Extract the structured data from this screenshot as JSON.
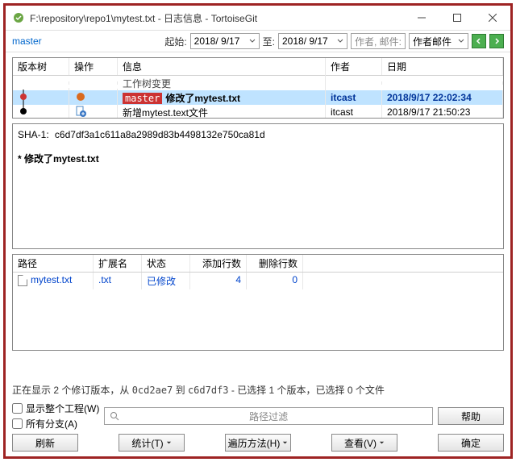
{
  "window": {
    "title": "F:\\repository\\repo1\\mytest.txt - 日志信息 - TortoiseGit"
  },
  "toolbar": {
    "branch": "master",
    "from_label": "起始:",
    "from_date": "2018/ 9/17",
    "to_label": "至:",
    "to_date": "2018/ 9/17",
    "search_placeholder": "作者, 邮件:",
    "filter_sel": "作者邮件"
  },
  "grid": {
    "hdr": {
      "tree": "版本树",
      "op": "操作",
      "info": "信息",
      "author": "作者",
      "date": "日期"
    },
    "wtc": "工作树变更",
    "rows": [
      {
        "branch": "master",
        "msg": "修改了mytest.txt",
        "author": "itcast",
        "date": "2018/9/17 22:02:34",
        "sel": true
      },
      {
        "msg": "新增mytest.text文件",
        "author": "itcast",
        "date": "2018/9/17 21:50:23",
        "sel": false
      }
    ]
  },
  "detail": {
    "sha_label": "SHA-1:",
    "sha": "c6d7df3a1c611a8a2989d83b4498132e750ca81d",
    "msg": "* 修改了mytest.txt"
  },
  "files": {
    "hdr": {
      "path": "路径",
      "ext": "扩展名",
      "status": "状态",
      "add": "添加行数",
      "del": "删除行数"
    },
    "rows": [
      {
        "path": "mytest.txt",
        "ext": ".txt",
        "status": "已修改",
        "add": "4",
        "del": "0"
      }
    ]
  },
  "status": {
    "p1": "正在显示 ",
    "revs": "2",
    "p2": " 个修订版本，从 ",
    "r1": "0cd2ae7",
    "p3": " 到 ",
    "r2": "c6d7df3",
    "p4": " - 已选择 ",
    "sel": "1",
    "p5": " 个版本，已选择 ",
    "f": "0",
    "p6": " 个文件"
  },
  "checks": {
    "whole": "显示整个工程(W)",
    "all": "所有分支(A)"
  },
  "filter": {
    "placeholder": "路径过滤"
  },
  "buttons": {
    "refresh": "刷新",
    "stats": "统计(T)",
    "walk": "遍历方法(H)",
    "view": "查看(V)",
    "help": "帮助",
    "ok": "确定"
  }
}
